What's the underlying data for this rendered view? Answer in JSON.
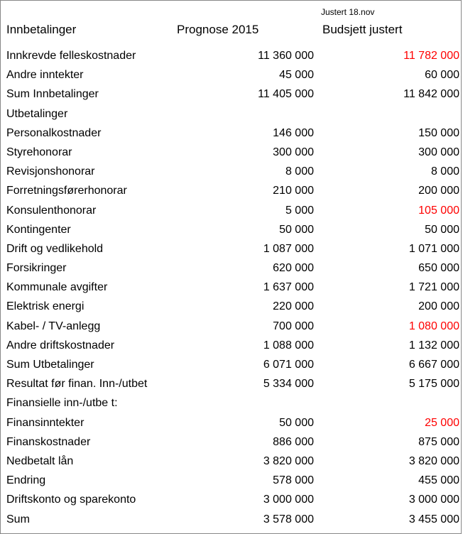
{
  "header": {
    "col1": "",
    "col2": "Prognose 2015",
    "col3_note": "Justert 18.nov",
    "col3": "Budsjett justert"
  },
  "sections": [
    {
      "label": "Innbetalinger",
      "is_header": true
    },
    {
      "label": "Innkrevde felleskostnader",
      "c2": "11 360 000",
      "c3": "11 782 000",
      "c3_red": true
    },
    {
      "label": "Andre inntekter",
      "c2": "45 000",
      "c3": "60 000"
    },
    {
      "label": "Sum Innbetalinger",
      "c2": "11 405 000",
      "c3": "11 842 000"
    },
    {
      "label": "Utbetalinger",
      "is_header": true
    },
    {
      "label": "Personalkostnader",
      "c2": "146 000",
      "c3": "150 000"
    },
    {
      "label": "Styrehonorar",
      "c2": "300 000",
      "c3": "300 000"
    },
    {
      "label": "Revisjonshonorar",
      "c2": "8 000",
      "c3": "8 000"
    },
    {
      "label": "Forretningsførerhonorar",
      "c2": "210 000",
      "c3": "200 000"
    },
    {
      "label": "Konsulenthonorar",
      "c2": "5 000",
      "c3": "105 000",
      "c3_red": true
    },
    {
      "label": "Kontingenter",
      "c2": "50 000",
      "c3": "50 000"
    },
    {
      "label": "Drift og vedlikehold",
      "c2": "1 087 000",
      "c3": "1 071 000"
    },
    {
      "label": "Forsikringer",
      "c2": "620 000",
      "c3": "650 000"
    },
    {
      "label": "Kommunale avgifter",
      "c2": "1 637 000",
      "c3": "1 721 000"
    },
    {
      "label": "Elektrisk energi",
      "c2": "220 000",
      "c3": "200 000"
    },
    {
      "label": "Kabel- / TV-anlegg",
      "c2": "700 000",
      "c3": "1 080 000",
      "c3_red": true
    },
    {
      "label": "Andre driftskostnader",
      "c2": "1 088 000",
      "c3": "1 132 000"
    },
    {
      "label": "Sum Utbetalinger",
      "c2": "6 071 000",
      "c3": "6 667 000"
    },
    {
      "label": "Resultat før finan. Inn-/utbet",
      "c2": "5 334 000",
      "c3": "5 175 000"
    },
    {
      "label": "Finansielle inn-/utbe  t:",
      "is_header": true
    },
    {
      "label": "Finansinntekter",
      "c2": "50 000",
      "c3": "25 000",
      "c3_red": true
    },
    {
      "label": "Finanskostnader",
      "c2": "886 000",
      "c3": "875 000"
    },
    {
      "label": "Nedbetalt lån",
      "c2": "3 820 000",
      "c3": "3 820 000"
    },
    {
      "label": "Endring",
      "c2": "578 000",
      "c3": "455 000"
    },
    {
      "label": "Driftskonto og sparekonto",
      "c2": "3 000 000",
      "c3": "3 000 000"
    },
    {
      "label": "Sum",
      "c2": "3 578 000",
      "c3": "3 455 000"
    }
  ],
  "chart_data": {
    "type": "table",
    "columns": [
      "",
      "Prognose 2015",
      "Budsjett justert"
    ],
    "note": "Justert 18.nov",
    "rows": [
      [
        "Innkrevde felleskostnader",
        11360000,
        11782000
      ],
      [
        "Andre inntekter",
        45000,
        60000
      ],
      [
        "Sum Innbetalinger",
        11405000,
        11842000
      ],
      [
        "Personalkostnader",
        146000,
        150000
      ],
      [
        "Styrehonorar",
        300000,
        300000
      ],
      [
        "Revisjonshonorar",
        8000,
        8000
      ],
      [
        "Forretningsførerhonorar",
        210000,
        200000
      ],
      [
        "Konsulenthonorar",
        5000,
        105000
      ],
      [
        "Kontingenter",
        50000,
        50000
      ],
      [
        "Drift og vedlikehold",
        1087000,
        1071000
      ],
      [
        "Forsikringer",
        620000,
        650000
      ],
      [
        "Kommunale avgifter",
        1637000,
        1721000
      ],
      [
        "Elektrisk energi",
        220000,
        200000
      ],
      [
        "Kabel- / TV-anlegg",
        700000,
        1080000
      ],
      [
        "Andre driftskostnader",
        1088000,
        1132000
      ],
      [
        "Sum Utbetalinger",
        6071000,
        6667000
      ],
      [
        "Resultat før finan. Inn-/utbet",
        5334000,
        5175000
      ],
      [
        "Finansinntekter",
        50000,
        25000
      ],
      [
        "Finanskostnader",
        886000,
        875000
      ],
      [
        "Nedbetalt lån",
        3820000,
        3820000
      ],
      [
        "Endring",
        578000,
        455000
      ],
      [
        "Driftskonto og sparekonto",
        3000000,
        3000000
      ],
      [
        "Sum",
        3578000,
        3455000
      ]
    ]
  }
}
